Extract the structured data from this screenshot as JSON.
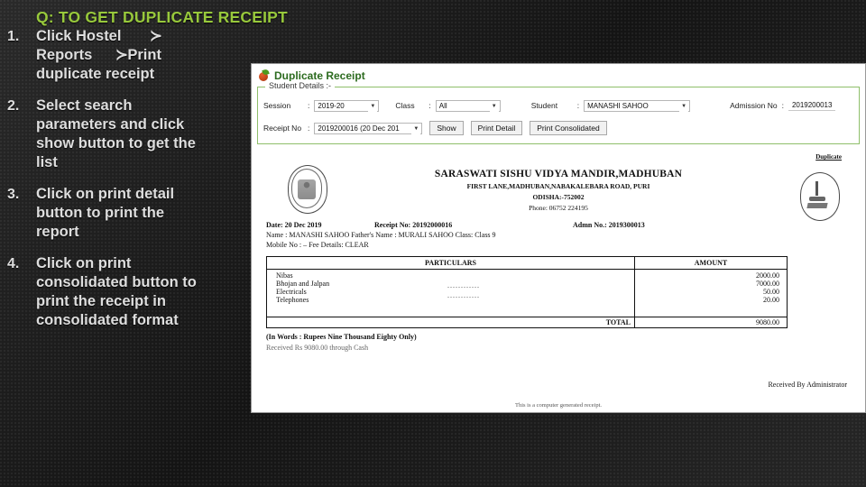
{
  "slide": {
    "question": "Q: TO GET DUPLICATE RECEIPT",
    "steps": [
      {
        "num": "1.",
        "lines": [
          "Click Hostel",
          "Reports",
          "duplicate receipt"
        ],
        "arrow1": "≺",
        "arrow2": "≺",
        "tail1": "",
        "tail2": "Print"
      },
      {
        "num": "2.",
        "lines": [
          "Select search",
          "parameters and click",
          "show button to get the",
          "list"
        ]
      },
      {
        "num": "3.",
        "lines": [
          "Click on print detail",
          "button to print the",
          "report"
        ]
      },
      {
        "num": "4.",
        "lines": [
          "Click on print",
          "consolidated button to",
          "print the receipt in",
          "consolidated format"
        ]
      }
    ],
    "accent_color": "#98c93c",
    "text_color": "#dedede"
  },
  "window": {
    "title": "Duplicate Receipt",
    "icon": "app-logo-icon",
    "fieldset_legend": "Student Details :-",
    "form": {
      "session_label": "Session",
      "session_value": "2019-20",
      "class_label": "Class",
      "class_value": "All",
      "student_label": "Student",
      "student_value": "MANASHI SAHOO",
      "admission_label": "Admission No",
      "admission_value": "2019200013",
      "receipt_label": "Receipt No",
      "receipt_value": "2019200016 (20 Dec 201",
      "colon": ":"
    },
    "buttons": {
      "show": "Show",
      "print_detail": "Print Detail",
      "print_consolidated": "Print Consolidated"
    }
  },
  "receipt": {
    "duplicate_tag": "Duplicate",
    "school_name": "SARASWATI SISHU VIDYA MANDIR,MADHUBAN",
    "address": "FIRST LANE,MADHUBAN,NABAKALEBARA ROAD, PURI",
    "state_pin": "ODISHA:-752002",
    "phone": "Phone: 06752 224195",
    "date_label": "Date:",
    "date_value": "20 Dec 2019",
    "receipt_no_label": "Receipt No:",
    "receipt_no_value": "20192000016",
    "admn_no_label": "Admn No.:",
    "admn_no_value": "2019300013",
    "name_line": "Name : MANASHI SAHOO   Father's Name : MURALI SAHOO   Class: Class 9",
    "mobile_line": "Mobile No : –    Fee Details: CLEAR",
    "table": {
      "headers": [
        "PARTICULARS",
        "AMOUNT"
      ],
      "rows": [
        {
          "particular": "Nibas",
          "amount": "2000.00",
          "dots": ""
        },
        {
          "particular": "Bhojan and Jalpan",
          "amount": "7000.00",
          "dots": "............"
        },
        {
          "particular": "Electricals",
          "amount": "50.00",
          "dots": "............"
        },
        {
          "particular": "Telephones",
          "amount": "20.00",
          "dots": ""
        }
      ],
      "total_label": "TOTAL",
      "total_value": "9080.00"
    },
    "in_words": "(In Words : Rupees Nine Thousand Eighty Only)",
    "received_line": "Received Rs 9080.00 through Cash",
    "signature": "Received By Administrator",
    "generated_note": "This is a computer generated receipt."
  }
}
